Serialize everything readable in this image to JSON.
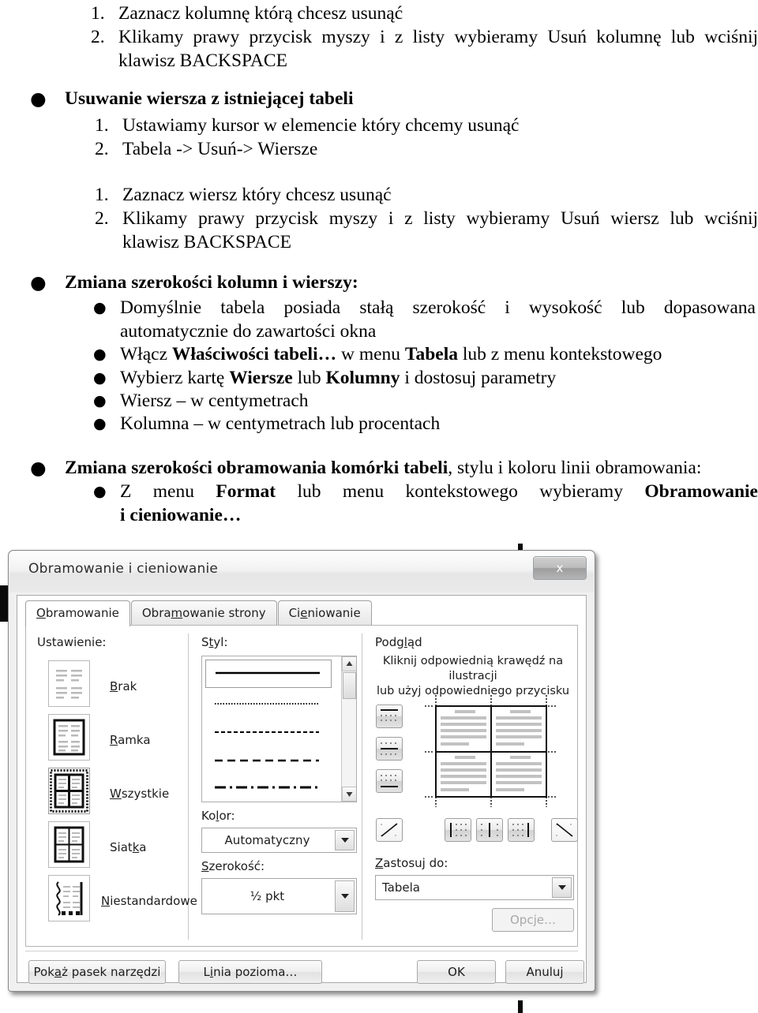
{
  "document": {
    "top_list": [
      {
        "num": "1.",
        "text": "Zaznacz kolumnę którą chcesz usunąć"
      },
      {
        "num": "2.",
        "text": "Klikamy prawy przycisk myszy i z listy wybieramy Usuń kolumnę lub wciśnij"
      },
      {
        "num": "",
        "text": "klawisz BACKSPACE"
      }
    ],
    "heading_1": "Usuwanie wiersza z istniejącej tabeli",
    "list_2": [
      {
        "num": "1.",
        "text": "Ustawiamy kursor w elemencie który chcemy usunąć"
      },
      {
        "num": "2.",
        "text": "Tabela -> Usuń-> Wiersze"
      }
    ],
    "list_3": [
      {
        "num": "1.",
        "text": "Zaznacz wiersz który chcesz usunąć"
      },
      {
        "num": "2.",
        "text": "Klikamy prawy przycisk myszy i z listy wybieramy Usuń wiersz lub wciśnij"
      },
      {
        "num": "",
        "text": "klawisz BACKSPACE"
      }
    ],
    "heading_2": "Zmiana szerokości kolumn i wierszy:",
    "sub_bullets": [
      {
        "plain_1": "Domyślnie tabela posiada stałą szerokość i wysokość lub dopasowana",
        "plain_2": "automatycznie do zawartości okna"
      },
      {
        "a": "Włącz ",
        "b1": "Właściwości tabeli…",
        "c": " w menu ",
        "b2": "Tabela",
        "d": " lub z menu kontekstowego"
      },
      {
        "a": "Wybierz kartę ",
        "b1": "Wiersze",
        "c": " lub ",
        "b2": "Kolumny",
        "d": " i dostosuj parametry"
      },
      {
        "plain_1": "Wiersz – w centymetrach"
      },
      {
        "plain_1": "Kolumna – w centymetrach lub procentach"
      }
    ],
    "heading_3_bold": "Zmiana szerokości obramowania komórki tabeli",
    "heading_3_rest": ", stylu i koloru linii obramowania:",
    "last_bullet": {
      "a": "Z menu ",
      "b1": "Format",
      "c": " lub menu kontekstowego wybieramy ",
      "b2": "Obramowanie",
      "d": "i cieniowanie…"
    }
  },
  "dialog": {
    "title": "Obramowanie i cieniowanie",
    "close_label": "x",
    "tabs": [
      {
        "label": "Obramowanie",
        "accel": "O",
        "active": true
      },
      {
        "label": "Obramowanie strony",
        "accel": "m",
        "active": false
      },
      {
        "label": "Cieniowanie",
        "accel": "e",
        "active": false
      }
    ],
    "settings_group_label": "Ustawienie:",
    "settings": [
      {
        "label": "Brak",
        "accel": "B",
        "icon": "border-none-icon",
        "selected": false
      },
      {
        "label": "Ramka",
        "accel": "R",
        "icon": "border-box-icon",
        "selected": false
      },
      {
        "label": "Wszystkie",
        "accel": "W",
        "icon": "border-all-icon",
        "selected": true
      },
      {
        "label": "Siatka",
        "accel": "k",
        "icon": "border-grid-icon",
        "selected": false
      },
      {
        "label": "Niestandardowe",
        "accel": "N",
        "icon": "border-custom-icon",
        "selected": false
      }
    ],
    "style_group_label": "Styl:",
    "style_items": [
      {
        "name": "solid",
        "selected": true
      },
      {
        "name": "dotted",
        "selected": false
      },
      {
        "name": "dashed-fine",
        "selected": false
      },
      {
        "name": "dashed",
        "selected": false
      },
      {
        "name": "dash-dot",
        "selected": false
      }
    ],
    "color_label": "Kolor:",
    "color_value": "Automatyczny",
    "width_label": "Szerokość:",
    "width_value": "½ pkt",
    "preview_label": "Podgląd",
    "preview_note_line1": "Kliknij odpowiednią krawędź na ilustracji",
    "preview_note_line2": "lub użyj odpowiedniego przycisku",
    "edge_buttons_left": [
      "border-top-icon",
      "border-middle-horizontal-icon",
      "border-bottom-icon"
    ],
    "edge_buttons_bottom": [
      "border-diag-up-icon",
      "border-left-icon",
      "border-inside-vertical-icon",
      "border-right-icon",
      "border-diag-down-icon"
    ],
    "apply_label": "Zastosuj do:",
    "apply_accel": "Z",
    "apply_value": "Tabela",
    "options_button": "Opcje…",
    "footer_buttons": [
      {
        "label": "Pokaż pasek narzędzi",
        "accel": "a",
        "name": "show-toolbar-button"
      },
      {
        "label": "Linia pozioma…",
        "accel": "i",
        "name": "horizontal-line-button"
      },
      {
        "label": "OK",
        "accel": "",
        "name": "ok-button"
      },
      {
        "label": "Anuluj",
        "accel": "",
        "name": "cancel-button"
      }
    ]
  },
  "colors": {
    "dialog_bg": "#f0f0f0",
    "panel_bg": "#ffffff",
    "text": "#1d1d1d",
    "border": "#a9a9a9",
    "preview_line": "#bdbdbd"
  }
}
